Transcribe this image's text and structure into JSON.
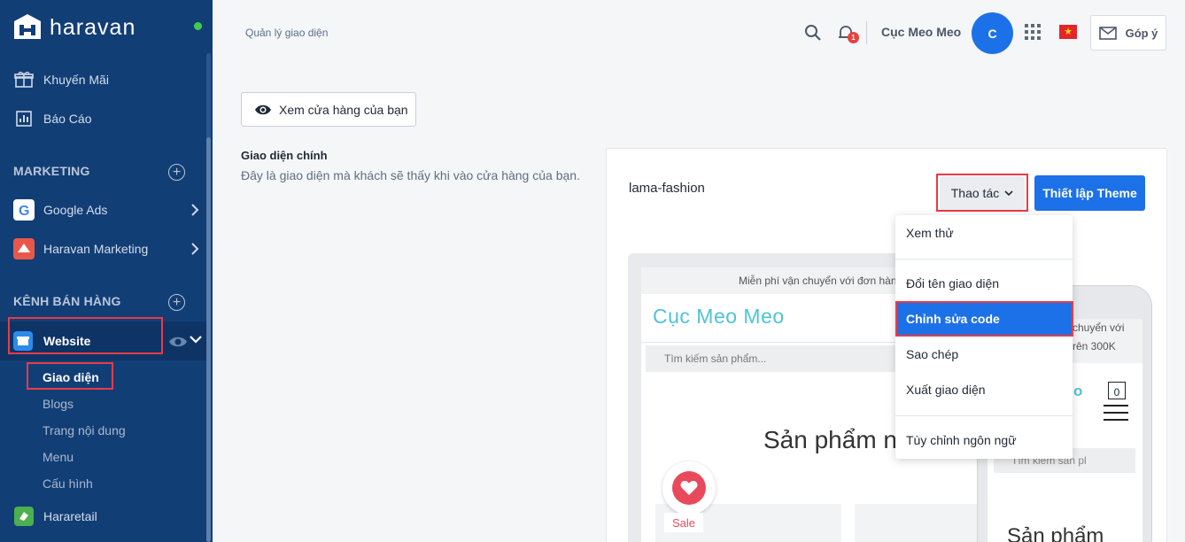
{
  "brand": {
    "name": "haravan"
  },
  "sidebar": {
    "items": [
      {
        "label": "Khuyến Mãi",
        "icon": "gift-icon"
      },
      {
        "label": "Báo Cáo",
        "icon": "report-chart-icon"
      }
    ],
    "marketing": {
      "title": "MARKETING",
      "items": [
        {
          "label": "Google Ads",
          "icon": "google-icon"
        },
        {
          "label": "Haravan Marketing",
          "icon": "haravan-marketing-icon"
        }
      ]
    },
    "sales_channels": {
      "title": "KÊNH BÁN HÀNG",
      "website": {
        "label": "Website",
        "sub_items": [
          "Giao diện",
          "Blogs",
          "Trang nội dung",
          "Menu",
          "Cấu hình"
        ]
      },
      "hararetail": {
        "label": "Hararetail"
      }
    }
  },
  "header": {
    "breadcrumb": "Quản lý giao diện",
    "notification_count": "1",
    "shop_name": "Cục Meo Meo",
    "avatar_initial": "C",
    "flag": "★",
    "feedback_label": "Góp ý"
  },
  "main": {
    "view_store_label": "Xem cửa hàng của bạn",
    "section_title": "Giao diện chính",
    "section_desc": "Đây là giao diện mà khách sẽ thấy khi vào cửa hàng của bạn.",
    "theme_name": "lama-fashion",
    "actions_label": "Thao tác",
    "setup_theme_label": "Thiết lập Theme"
  },
  "dropdown": {
    "items": [
      "Xem thử",
      "Đổi tên giao diện",
      "Chỉnh sửa code",
      "Sao chép",
      "Xuất giao diện",
      "Tùy chỉnh ngôn ngữ"
    ],
    "active": "Chỉnh sửa code"
  },
  "preview": {
    "desktop": {
      "top_bar": "Miễn phí vận chuyển với đơn hàng",
      "brand": "Cục Meo Meo",
      "search_placeholder": "Tìm kiếm sản phẩm...",
      "hero": "Sản phẩm n",
      "sale": "Sale"
    },
    "mobile": {
      "top_bar_1": "chuyển với",
      "top_bar_2": "rên 300K",
      "brand_fragment": "o",
      "cart_count": "0",
      "search_placeholder": "Tìm kiếm sản pl",
      "hero": "Sản phẩm"
    }
  },
  "colors": {
    "sidebar_bg": "#123e76",
    "primary": "#1d71e8",
    "highlight": "#e83b46",
    "brand_teal": "#4fc3d8",
    "sale": "#e94a5b"
  }
}
